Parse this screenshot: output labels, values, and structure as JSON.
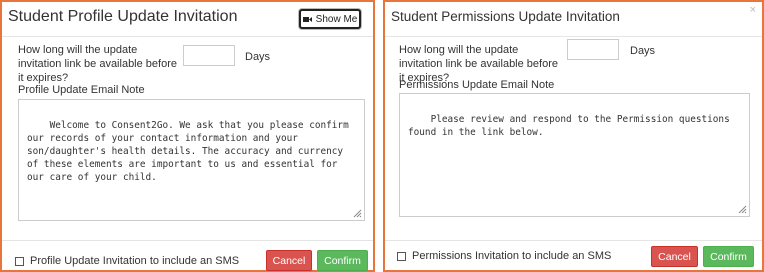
{
  "profile_dialog": {
    "title": "Student Profile Update Invitation",
    "show_me_label": "Show Me",
    "expiry_question": "How long will the update invitation link be available before it expires?",
    "days_value": "",
    "days_unit": "Days",
    "note_label": "Profile Update Email Note",
    "note_text": "Welcome to Consent2Go. We ask that you please confirm our records of your contact information and your son/daughter's health details. The accuracy and currency of these elements are important to us and essential for our care of your child.",
    "sms_label": "Profile Update Invitation to include an SMS",
    "sms_checked": false,
    "cancel_label": "Cancel",
    "confirm_label": "Confirm"
  },
  "permissions_dialog": {
    "title": "Student Permissions Update Invitation",
    "close_label": "×",
    "expiry_question": "How long will the update invitation link be available before it expires?",
    "days_value": "",
    "days_unit": "Days",
    "note_label": "Permissions Update Email Note",
    "note_text": "Please review and respond to the Permission questions found in the link below.",
    "sms_label": "Permissions Invitation to include an SMS",
    "sms_checked": false,
    "cancel_label": "Cancel",
    "confirm_label": "Confirm"
  },
  "colors": {
    "border_accent": "#e8763a",
    "cancel": "#d9534f",
    "confirm": "#5cb85c"
  },
  "icons": {
    "show_me": "video-camera-icon",
    "resize": "resize-grip-icon"
  }
}
